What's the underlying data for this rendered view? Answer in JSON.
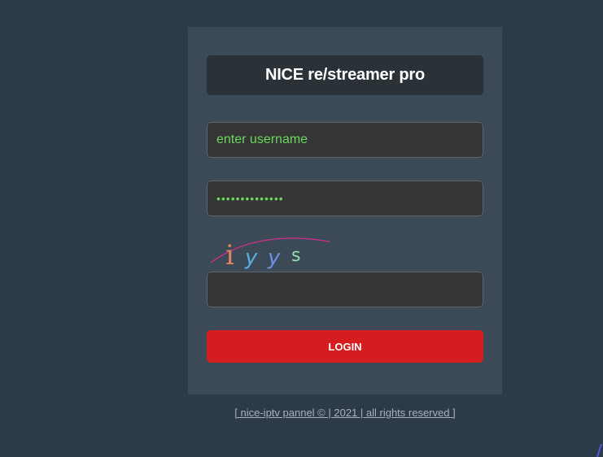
{
  "login_panel": {
    "title": "NICE re/streamer pro",
    "username": {
      "placeholder": "enter username",
      "value": ""
    },
    "password": {
      "masked_value": "••••••••••••••"
    },
    "captcha": {
      "characters": [
        "i",
        "y",
        "y",
        "s"
      ],
      "colors": [
        "#e0845f",
        "#5aaee0",
        "#6f8fe6",
        "#8fe0b0"
      ],
      "input_value": ""
    },
    "login_label": "LOGIN"
  },
  "footer": {
    "text": "[ nice-iptv pannel © | 2021 | all rights reserved ]"
  },
  "colors": {
    "background": "#2c3a49",
    "panel": "#3c4a58",
    "title_box": "#2a3237",
    "accent_text": "#6ad85f",
    "login_button": "#d51d1f"
  }
}
